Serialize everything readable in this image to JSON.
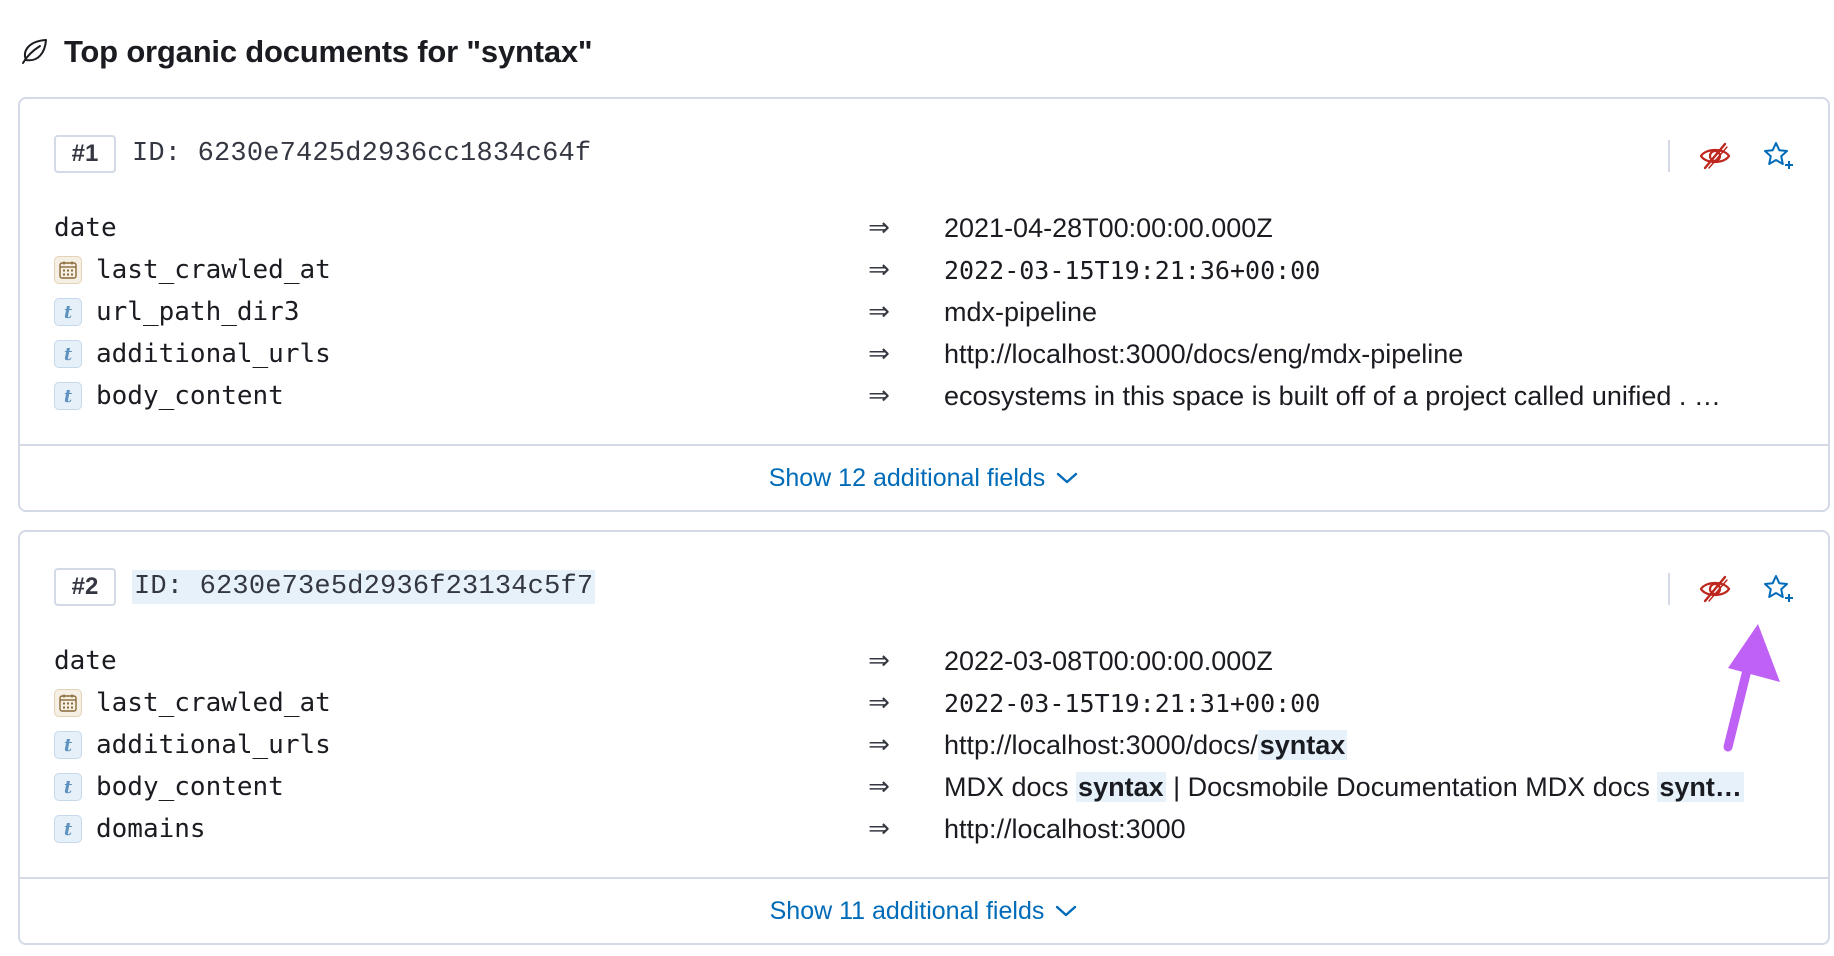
{
  "panel": {
    "title": "Top organic documents for \"syntax\"",
    "icon": "leaf-icon"
  },
  "results": [
    {
      "rank": "#1",
      "id": "ID: 6230e7425d2936cc1834c64f",
      "fields": [
        {
          "name": "date",
          "type": "none",
          "value": "2021-04-28T00:00:00.000Z"
        },
        {
          "name": "last_crawled_at",
          "type": "date",
          "value": "2022-03-15T19:21:36+00:00"
        },
        {
          "name": "url_path_dir3",
          "type": "text",
          "value": "mdx-pipeline"
        },
        {
          "name": "additional_urls",
          "type": "text",
          "value": "http://localhost:3000/docs/eng/mdx-pipeline"
        },
        {
          "name": "body_content",
          "type": "text",
          "value": "ecosystems in this space is built off of a project called unified . …"
        }
      ],
      "show_more": "Show 12 additional fields"
    },
    {
      "rank": "#2",
      "id": "ID: 6230e73e5d2936f23134c5f7",
      "fields": [
        {
          "name": "date",
          "type": "none",
          "value": "2022-03-08T00:00:00.000Z"
        },
        {
          "name": "last_crawled_at",
          "type": "date",
          "value": "2022-03-15T19:21:31+00:00"
        },
        {
          "name": "additional_urls",
          "type": "text",
          "value_parts": [
            "http://localhost:3000/docs/",
            "syntax"
          ]
        },
        {
          "name": "body_content",
          "type": "text",
          "value_parts": [
            "MDX docs ",
            "syntax",
            " | Docsmobile Documentation MDX docs ",
            "synt…"
          ]
        },
        {
          "name": "domains",
          "type": "text",
          "value": "http://localhost:3000"
        }
      ],
      "show_more": "Show 11 additional fields"
    }
  ],
  "actions": {
    "hide_icon": "eye-slash-icon",
    "pin_icon": "star-plus-icon",
    "hide_color": "#bd271e",
    "pin_color": "#006bb8"
  },
  "colors": {
    "link": "#006bb8",
    "border": "#d3dae6",
    "highlight": "#e6f1fa",
    "annotation": "#c061f5"
  },
  "field_arrow": "⇒"
}
